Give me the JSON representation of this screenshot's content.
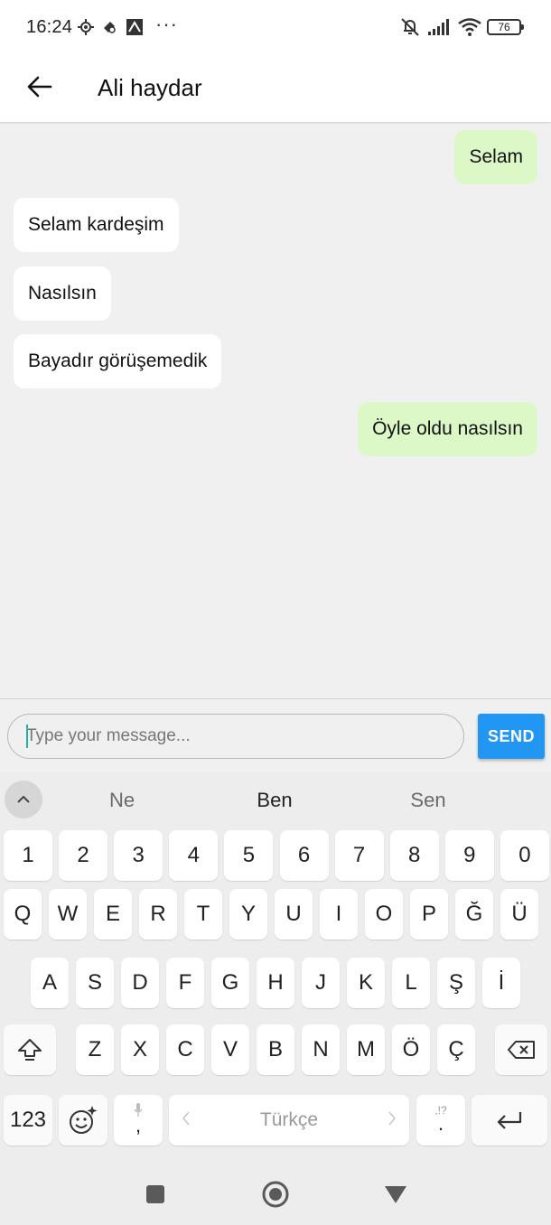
{
  "status_bar": {
    "time": "16:24",
    "battery": "76",
    "more": "···"
  },
  "app_bar": {
    "title": "Ali haydar"
  },
  "messages": [
    {
      "text": "Selam",
      "direction": "outgoing"
    },
    {
      "text": "Selam kardeşim",
      "direction": "incoming"
    },
    {
      "text": "Nasılsın",
      "direction": "incoming"
    },
    {
      "text": "Bayadır görüşemedik",
      "direction": "incoming"
    },
    {
      "text": "Öyle oldu nasılsın",
      "direction": "outgoing"
    }
  ],
  "input": {
    "placeholder": "Type your message...",
    "value": "",
    "send_label": "SEND"
  },
  "keyboard": {
    "suggestions": [
      "Ne",
      "Ben",
      "Sen"
    ],
    "row_numbers": [
      "1",
      "2",
      "3",
      "4",
      "5",
      "6",
      "7",
      "8",
      "9",
      "0"
    ],
    "row_q": [
      "Q",
      "W",
      "E",
      "R",
      "T",
      "Y",
      "U",
      "I",
      "O",
      "P",
      "Ğ",
      "Ü"
    ],
    "row_a": [
      "A",
      "S",
      "D",
      "F",
      "G",
      "H",
      "J",
      "K",
      "L",
      "Ş",
      "İ"
    ],
    "row_z": [
      "Z",
      "X",
      "C",
      "V",
      "B",
      "N",
      "M",
      "Ö",
      "Ç"
    ],
    "symbols_label": "123",
    "comma_label": ",",
    "space_label": "Türkçe",
    "period_label": ".",
    "punct_hint": ",!?"
  },
  "colors": {
    "outgoing_bubble": "#dcf8c6",
    "incoming_bubble": "#ffffff",
    "send_button": "#2196f3",
    "caret": "#1fb5a3"
  },
  "icons": {
    "status": [
      "settings-icon",
      "notification-icon",
      "app-icon",
      "mute-icon",
      "signal-icon",
      "wifi-icon",
      "battery-icon"
    ],
    "nav": [
      "recents-icon",
      "home-icon",
      "back-triangle-icon"
    ]
  }
}
